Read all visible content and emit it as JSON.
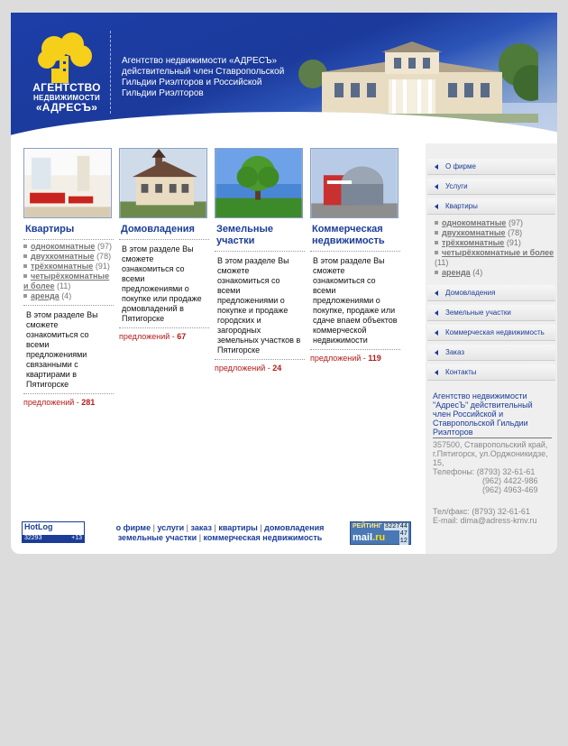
{
  "header": {
    "logo": {
      "line1": "АГЕНТСТВО",
      "line2": "НЕДВИЖИМОСТИ",
      "line3": "«АДРЕСЪ»"
    },
    "description": "Агентство недвижимости «АДРЕСЪ» действительный член Ставропольской Гильдии Риэлторов и Российской Гильдии Риэлторов"
  },
  "columns": [
    {
      "title": "Квартиры",
      "sublist": [
        {
          "label": "однокомнатные",
          "count": "(97)"
        },
        {
          "label": "двухкомнатные",
          "count": "(78)"
        },
        {
          "label": "трёхкомнатные",
          "count": "(91)"
        },
        {
          "label": "четырёхкомнатные и более",
          "count": "(11)"
        },
        {
          "label": "аренда",
          "count": "(4)"
        }
      ],
      "description": "В этом разделе Вы сможете ознакомиться со всеми предложениями связанными с квартирами в Пятигорске",
      "offers_label": "предложений - ",
      "offers_count": "281"
    },
    {
      "title": "Домовладения",
      "description": "В этом разделе Вы сможете ознакомиться со всеми предложениями о покупке или продаже домовладений в Пятигорске",
      "offers_label": "предложений - ",
      "offers_count": "67"
    },
    {
      "title": "Земельные участки",
      "description": "В этом разделе Вы сможете ознакомиться со всеми предложениями о покупке и продаже городских и загородных земельных участков в Пятигорске",
      "offers_label": "предложений - ",
      "offers_count": "24"
    },
    {
      "title": "Коммерческая недвижимость",
      "description": "В этом разделе Вы сможете ознакомиться со всеми предложениями о покупке, продаже или сдаче вnaем объектов коммерческой недвижимости",
      "offers_label": "предложений - ",
      "offers_count": "119"
    }
  ],
  "sidebar": {
    "menu_top": [
      "О фирме",
      "Услуги",
      "Квартиры"
    ],
    "submenu": [
      {
        "label": "однокомнатные",
        "count": "(97)"
      },
      {
        "label": "двухкомнатные",
        "count": "(78)"
      },
      {
        "label": "трёхкомнатные",
        "count": "(91)"
      },
      {
        "label": "четырёхкомнатные и более",
        "count": "(11)"
      },
      {
        "label": "аренда",
        "count": "(4)"
      }
    ],
    "menu_bottom": [
      "Домовладения",
      "Земельные участки",
      "Коммерческая недвижимость",
      "Заказ",
      "Контакты"
    ],
    "contacts": {
      "agency": "Агентство недвижимости \"АдресЪ\" действительный член Российской и Ставропольской Гильдии Риэлторов",
      "address": "357500, Ставропольский край, г.Пятигорск, ул.Орджоникидзе, 15,",
      "phones_label": "Телефоны: (8793) 32-61-61",
      "phone2": "(962) 4422-986",
      "phone3": "(962) 4963-469",
      "fax": "Тел/факс: (8793) 32-61-61",
      "email": "E-mail: dima@adress-kmv.ru"
    }
  },
  "footer": {
    "links_row1": [
      "о фирме",
      "услуги",
      "заказ",
      "квартиры",
      "домовладения"
    ],
    "links_row2": [
      "земельные участки",
      "коммерческая недвижимость"
    ],
    "counter_left": {
      "name": "HotLog",
      "value1": "32293",
      "value2": "+13"
    },
    "counter_right": {
      "label": "РЕЙТИНГ",
      "n1": "322744",
      "n2": "47",
      "n3": "12",
      "logo_main": "mail",
      "logo_ru": ".ru"
    }
  }
}
